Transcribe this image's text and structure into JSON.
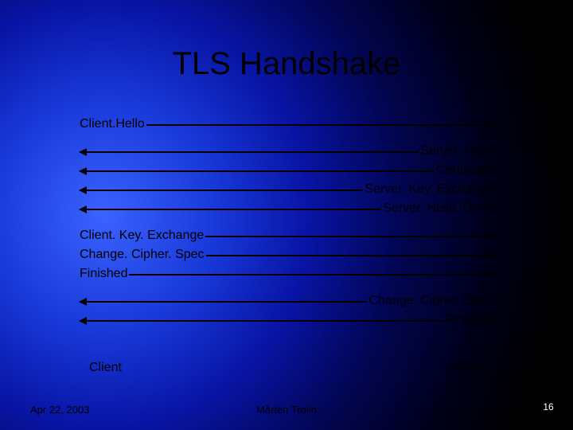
{
  "title": "TLS Handshake",
  "parties": {
    "client": "Client",
    "server": "Server"
  },
  "messages": [
    {
      "label": "Client.Hello",
      "from": "client"
    },
    {
      "label": "Server. Hello",
      "from": "server"
    },
    {
      "label": "Certificate",
      "from": "server"
    },
    {
      "label": "Server. Key. Exchange",
      "from": "server"
    },
    {
      "label": "Server. Hello. Done",
      "from": "server"
    },
    {
      "label": "Client. Key. Exchange",
      "from": "client"
    },
    {
      "label": "Change. Cipher. Spec",
      "from": "client"
    },
    {
      "label": "Finished",
      "from": "client"
    },
    {
      "label": "Change. Cipher. Spec",
      "from": "server"
    },
    {
      "label": "Finished",
      "from": "server"
    }
  ],
  "footer": {
    "date": "Apr 22, 2003",
    "author": "Mårten Trolin",
    "page": "16"
  }
}
